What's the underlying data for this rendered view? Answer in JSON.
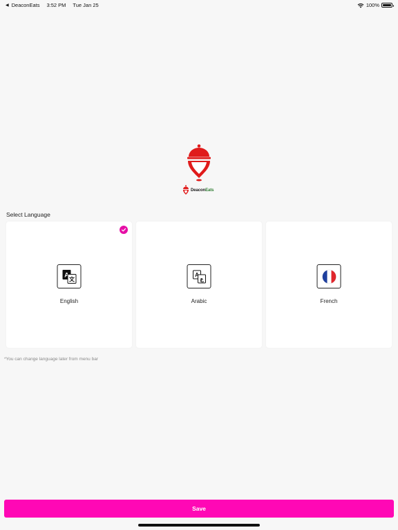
{
  "status_bar": {
    "back_app": "DeaconEats",
    "time": "3:52 PM",
    "date": "Tue Jan 25",
    "battery": "100%",
    "icons": [
      "back-arrow-icon",
      "wifi-icon",
      "battery-icon"
    ]
  },
  "logo": {
    "brand_prefix": "Deacon",
    "brand_suffix": "Eats",
    "colors": {
      "pin": "#e01b1b",
      "brand_suffix": "#2e7d32"
    }
  },
  "language": {
    "title": "Select Language",
    "options": [
      {
        "label": "English",
        "icon": "translate-icon",
        "selected": true
      },
      {
        "label": "Arabic",
        "icon": "translate-arabic-icon",
        "selected": false
      },
      {
        "label": "French",
        "icon": "french-flag-icon",
        "selected": false
      }
    ],
    "note": "*You can change language later from menu bar"
  },
  "actions": {
    "save_label": "Save"
  },
  "colors": {
    "accent": "#ff08b5",
    "check": "#e60ea6",
    "background": "#f7f7f7",
    "card": "#ffffff"
  }
}
